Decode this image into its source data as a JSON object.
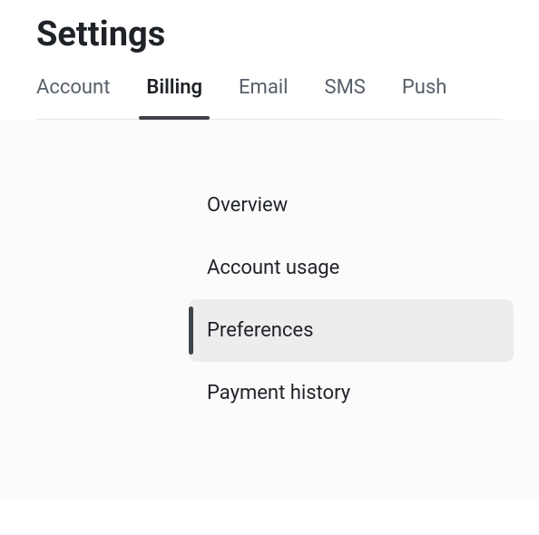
{
  "page": {
    "title": "Settings"
  },
  "tabs": [
    {
      "label": "Account",
      "active": false
    },
    {
      "label": "Billing",
      "active": true
    },
    {
      "label": "Email",
      "active": false
    },
    {
      "label": "SMS",
      "active": false
    },
    {
      "label": "Push",
      "active": false
    }
  ],
  "subnav": [
    {
      "label": "Overview",
      "active": false
    },
    {
      "label": "Account usage",
      "active": false
    },
    {
      "label": "Preferences",
      "active": true
    },
    {
      "label": "Payment history",
      "active": false
    }
  ]
}
